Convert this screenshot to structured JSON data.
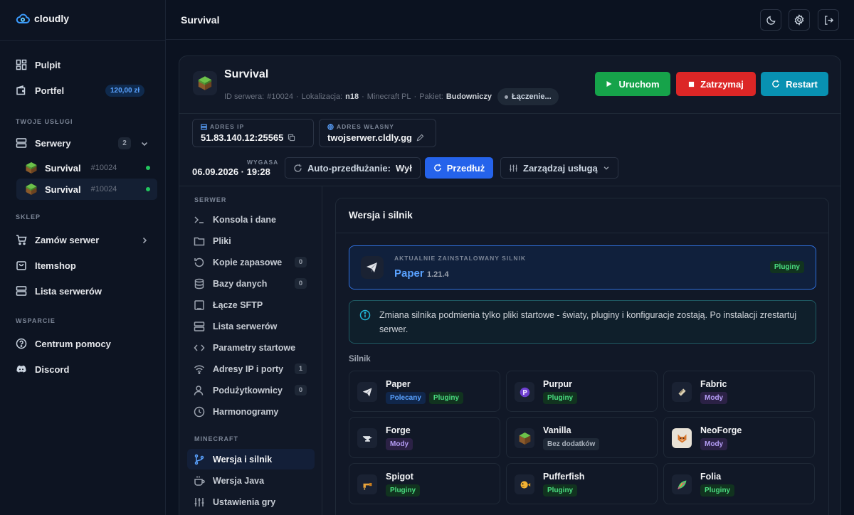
{
  "brand": {
    "name": "cloudly"
  },
  "sidebar": {
    "dashboard": "Pulpit",
    "wallet": "Portfel",
    "balance": "120,00 zł",
    "services_label": "TWOJE USŁUGI",
    "servers": "Serwery",
    "servers_count": "2",
    "server_items": [
      {
        "name": "Survival",
        "id": "#10024"
      },
      {
        "name": "Survival",
        "id": "#10024"
      }
    ],
    "shop_label": "SKLEP",
    "order": "Zamów serwer",
    "itemshop": "Itemshop",
    "server_list": "Lista serwerów",
    "support_label": "WSPARCIE",
    "help": "Centrum pomocy",
    "discord": "Discord"
  },
  "topbar": {
    "title": "Survival"
  },
  "server": {
    "name": "Survival",
    "id_label": "ID serwera:",
    "id": "#10024",
    "loc_label": "Lokalizacja:",
    "loc": "n18",
    "game": "Minecraft PL",
    "plan_label": "Pakiet:",
    "plan": "Budowniczy",
    "status": "Łączenie..."
  },
  "actions": {
    "start": "Uruchom",
    "stop": "Zatrzymaj",
    "restart": "Restart"
  },
  "address": {
    "ip_label": "ADRES IP",
    "ip": "51.83.140.12:25565",
    "custom_label": "ADRES WŁASNY",
    "custom": "twojserwer.cldly.gg"
  },
  "expiry": {
    "label": "WYGASA",
    "date": "06.09.2026 · 19:28"
  },
  "renew": {
    "auto_label": "Auto-przedłużanie:",
    "auto_value": "Wył",
    "extend": "Przedłuż",
    "manage": "Zarządzaj usługą"
  },
  "subnav": {
    "server_label": "SERWER",
    "minecraft_label": "MINECRAFT",
    "items": [
      {
        "label": "Konsola i dane"
      },
      {
        "label": "Pliki"
      },
      {
        "label": "Kopie zapasowe",
        "badge": "0"
      },
      {
        "label": "Bazy danych",
        "badge": "0"
      },
      {
        "label": "Łącze SFTP"
      },
      {
        "label": "Lista serwerów"
      },
      {
        "label": "Parametry startowe"
      },
      {
        "label": "Adresy IP i porty",
        "badge": "1"
      },
      {
        "label": "Podużytkownicy",
        "badge": "0"
      },
      {
        "label": "Harmonogramy"
      }
    ],
    "mc_items": [
      {
        "label": "Wersja i silnik"
      },
      {
        "label": "Wersja Java"
      },
      {
        "label": "Ustawienia gry"
      }
    ]
  },
  "panel": {
    "title": "Wersja i silnik",
    "current_label": "AKTUALNIE ZAINSTALOWANY SILNIK",
    "current_name": "Paper",
    "current_version": "1.21.4",
    "current_tag": "Pluginy",
    "info": "Zmiana silnika podmienia tylko pliki startowe - światy, pluginy i konfiguracje zostają. Po instalacji zrestartuj serwer.",
    "engines_label": "Silnik",
    "engines": [
      {
        "name": "Paper",
        "tags": [
          "Polecany",
          "Pluginy"
        ]
      },
      {
        "name": "Purpur",
        "tags": [
          "Pluginy"
        ]
      },
      {
        "name": "Fabric",
        "tags": [
          "Mody"
        ]
      },
      {
        "name": "Forge",
        "tags": [
          "Mody"
        ]
      },
      {
        "name": "Vanilla",
        "tags": [
          "Bez dodatków"
        ]
      },
      {
        "name": "NeoForge",
        "tags": [
          "Mody"
        ]
      },
      {
        "name": "Spigot",
        "tags": [
          "Pluginy"
        ]
      },
      {
        "name": "Pufferfish",
        "tags": [
          "Pluginy"
        ]
      },
      {
        "name": "Folia",
        "tags": [
          "Pluginy"
        ]
      }
    ]
  },
  "colors": {
    "accent": "#2563eb",
    "start": "#16a34a",
    "stop": "#dc2626",
    "restart": "#0891b2"
  }
}
